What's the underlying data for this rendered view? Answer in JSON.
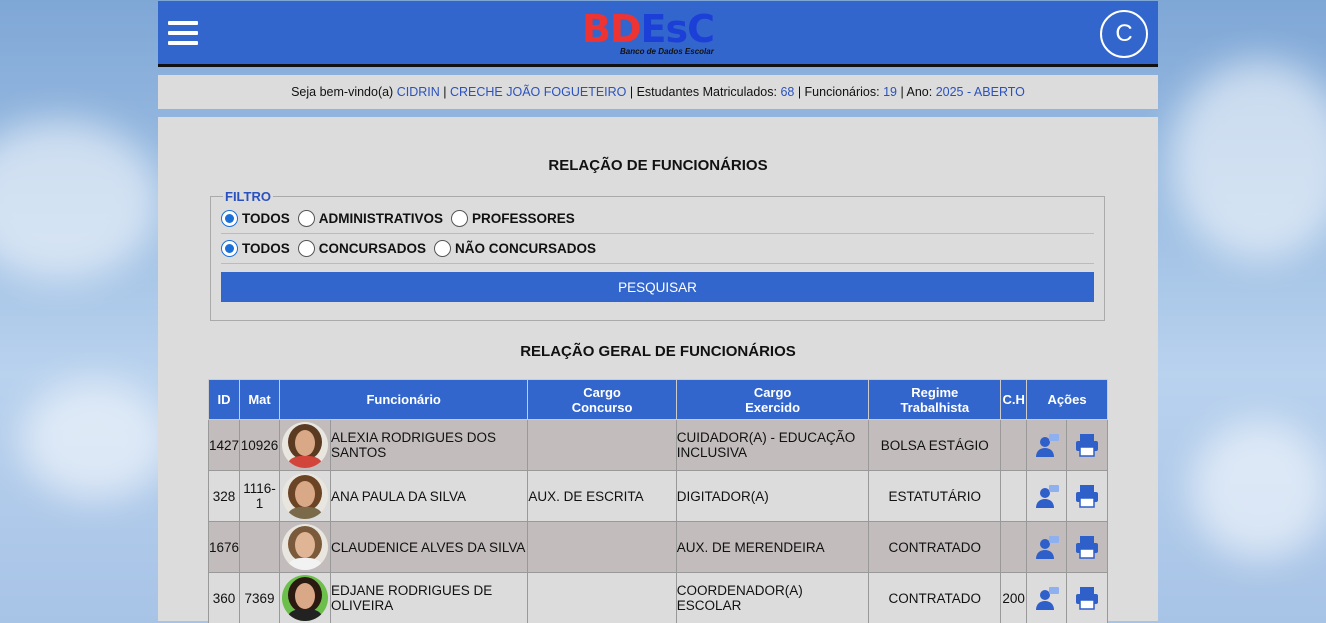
{
  "header": {
    "logo_text": "BDEsC",
    "logo_sub": "Banco de Dados Escolar",
    "user_initial": "C"
  },
  "infobar": {
    "welcome": "Seja bem-vindo(a)",
    "user": "CIDRIN",
    "school": "CRECHE JOÃO FOGUETEIRO",
    "students_label": "Estudantes Matriculados:",
    "students": "68",
    "staff_label": "Funcionários:",
    "staff": "19",
    "year_label": "Ano:",
    "year": "2025 - ABERTO"
  },
  "page_title": "RELAÇÃO DE FUNCIONÁRIOS",
  "filter": {
    "legend": "FILTRO",
    "row1": [
      {
        "label": "TODOS",
        "checked": true
      },
      {
        "label": "ADMINISTRATIVOS",
        "checked": false
      },
      {
        "label": "PROFESSORES",
        "checked": false
      }
    ],
    "row2": [
      {
        "label": "TODOS",
        "checked": true
      },
      {
        "label": "CONCURSADOS",
        "checked": false
      },
      {
        "label": "NÃO CONCURSADOS",
        "checked": false
      }
    ],
    "search_button": "PESQUISAR"
  },
  "table_title": "RELAÇÃO GERAL DE FUNCIONÁRIOS",
  "table": {
    "headers": {
      "id": "ID",
      "mat": "Mat",
      "funcionario": "Funcionário",
      "cargo_concurso_1": "Cargo",
      "cargo_concurso_2": "Concurso",
      "cargo_exercido_1": "Cargo",
      "cargo_exercido_2": "Exercido",
      "regime_1": "Regime",
      "regime_2": "Trabalhista",
      "ch": "C.H",
      "acoes": "Ações"
    },
    "rows": [
      {
        "id": "1427",
        "mat": "10926",
        "nome": "ALEXIA RODRIGUES DOS SANTOS",
        "cargo_concurso": "",
        "cargo_exercido": "CUIDADOR(A) - EDUCAÇÃO INCLUSIVA",
        "regime": "BOLSA ESTÁGIO",
        "ch": ""
      },
      {
        "id": "328",
        "mat": "1116-1",
        "nome": "ANA PAULA DA SILVA",
        "cargo_concurso": "AUX. DE ESCRITA",
        "cargo_exercido": "DIGITADOR(A)",
        "regime": "ESTATUTÁRIO",
        "ch": ""
      },
      {
        "id": "1676",
        "mat": "",
        "nome": "CLAUDENICE ALVES DA SILVA",
        "cargo_concurso": "",
        "cargo_exercido": "AUX. DE MERENDEIRA",
        "regime": "CONTRATADO",
        "ch": ""
      },
      {
        "id": "360",
        "mat": "7369",
        "nome": "EDJANE RODRIGUES DE OLIVEIRA",
        "cargo_concurso": "",
        "cargo_exercido": "COORDENADOR(A) ESCOLAR",
        "regime": "CONTRATADO",
        "ch": "200"
      }
    ]
  },
  "colors": {
    "primary": "#3366cc",
    "row_odd": "#c2bcbc",
    "row_even": "#dcdcdc",
    "link": "#2a52be"
  }
}
